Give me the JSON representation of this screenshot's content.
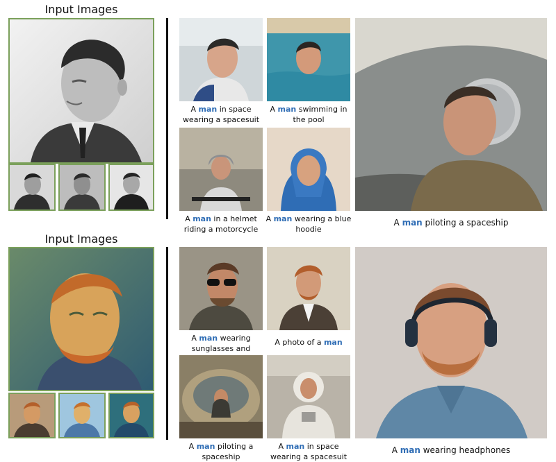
{
  "rows": [
    {
      "heading": "Input Images",
      "captions": [
        {
          "pre": "A ",
          "hl": "man",
          "post": " in space\nwearing a spacesuit"
        },
        {
          "pre": "A ",
          "hl": "man",
          "post": " swimming in\nthe pool"
        },
        {
          "pre": "A ",
          "hl": "man",
          "post": " in a helmet\nriding a motorcycle"
        },
        {
          "pre": "A ",
          "hl": "man",
          "post": " wearing a blue\nhoodie"
        }
      ],
      "big_caption": {
        "pre": "A ",
        "hl": "man",
        "post": " piloting a spaceship"
      }
    },
    {
      "heading": "Input Images",
      "captions": [
        {
          "pre": "A ",
          "hl": "man",
          "post": " wearing\nsunglasses and necklace"
        },
        {
          "pre": "A photo of a ",
          "hl": "man",
          "post": ""
        },
        {
          "pre": "A ",
          "hl": "man",
          "post": " piloting a\nspaceship"
        },
        {
          "pre": "A ",
          "hl": "man",
          "post": " in space\nwearing a spacesuit"
        }
      ],
      "big_caption": {
        "pre": "A ",
        "hl": "man",
        "post": " wearing headphones"
      }
    }
  ],
  "colors": {
    "frame": "#7ba05b",
    "highlight": "#2f6db5"
  }
}
